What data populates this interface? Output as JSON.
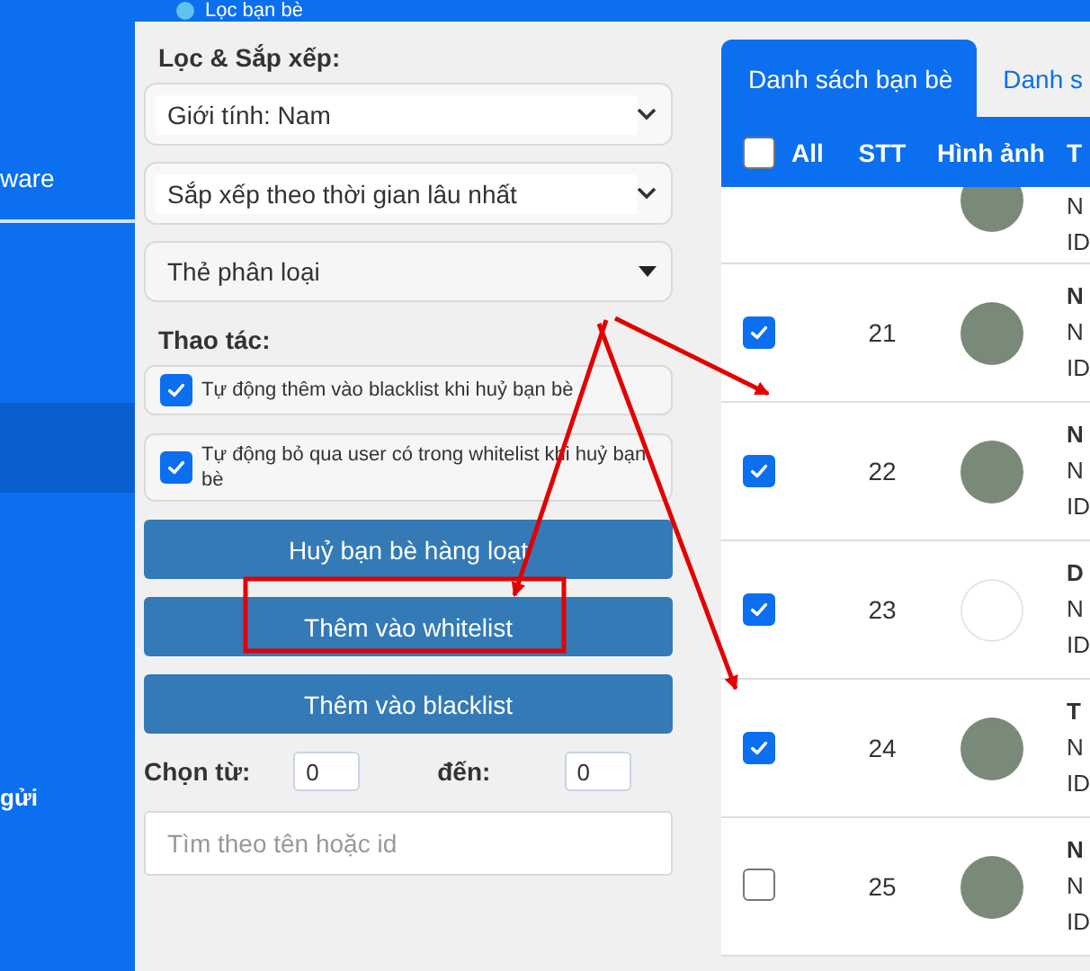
{
  "header": {
    "title": "Lọc bạn bè"
  },
  "sidebar": {
    "items": [
      {
        "label": "ware",
        "selected": false
      },
      {
        "selected": true
      },
      {
        "label": "gửi",
        "selected": false
      }
    ]
  },
  "filter_panel": {
    "heading": "Lọc & Sắp xếp:",
    "selects": [
      {
        "kind": "select",
        "value": "Giới tính: Nam"
      },
      {
        "kind": "select",
        "value": "Sắp xếp theo thời gian lâu nhất"
      },
      {
        "kind": "dropdown",
        "value": "Thẻ phân loại"
      }
    ],
    "actions_heading": "Thao tác:",
    "options": [
      {
        "label": "Tự động thêm vào blacklist khi huỷ bạn bè",
        "checked": true
      },
      {
        "label": "Tự động bỏ qua user có trong whitelist khi huỷ bạn bè",
        "checked": true
      }
    ],
    "buttons": [
      "Huỷ bạn bè hàng loạt",
      "Thêm vào whitelist",
      "Thêm vào blacklist"
    ],
    "range": {
      "from_label": "Chọn từ:",
      "from_value": "0",
      "to_label": "đến:",
      "to_value": "0"
    },
    "search": {
      "placeholder": "Tìm theo tên hoặc id"
    }
  },
  "tabs": [
    {
      "label": "Danh sách bạn bè",
      "selected": true
    },
    {
      "label": "Danh s",
      "selected": false
    }
  ],
  "table": {
    "select_all": {
      "label": "All",
      "checked": false
    },
    "columns": [
      "STT",
      "Hình ảnh",
      "T"
    ],
    "rows": [
      {
        "kind": "partial",
        "lines": [
          "N",
          "ID"
        ]
      },
      {
        "kind": "photo",
        "checked": true,
        "stt": "21",
        "lines": [
          "N",
          "N",
          "ID"
        ]
      },
      {
        "kind": "photo",
        "checked": true,
        "stt": "22",
        "lines": [
          "N",
          "N",
          "ID"
        ]
      },
      {
        "kind": "logo",
        "checked": true,
        "stt": "23",
        "lines": [
          "D",
          "N",
          "ID"
        ]
      },
      {
        "kind": "photo",
        "checked": true,
        "stt": "24",
        "lines": [
          "T",
          "N",
          "ID"
        ]
      },
      {
        "kind": "photo",
        "checked": false,
        "stt": "25",
        "lines": [
          "N",
          "N",
          "ID"
        ]
      }
    ]
  }
}
